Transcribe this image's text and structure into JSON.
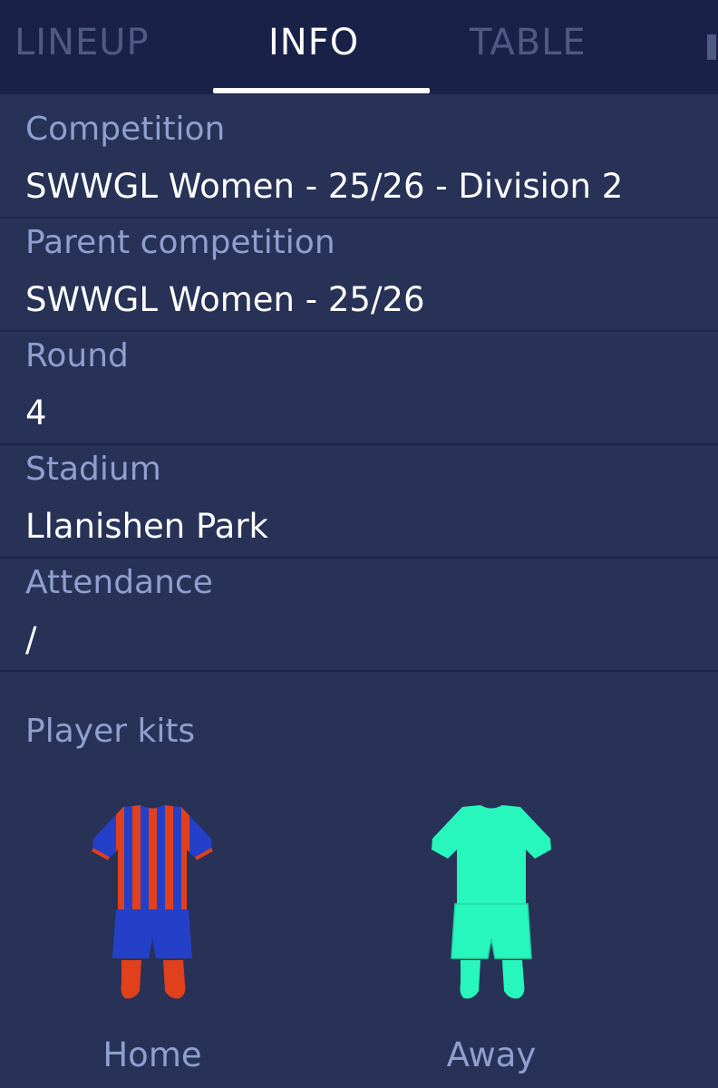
{
  "tabs": [
    {
      "label": "LINEUP",
      "active": false
    },
    {
      "label": "INFO",
      "active": true
    },
    {
      "label": "TABLE",
      "active": false
    }
  ],
  "info": {
    "competition": {
      "label": "Competition",
      "value": "SWWGL Women - 25/26 - Division 2"
    },
    "parent_competition": {
      "label": "Parent competition",
      "value": "SWWGL Women - 25/26"
    },
    "round": {
      "label": "Round",
      "value": "4"
    },
    "stadium": {
      "label": "Stadium",
      "value": "Llanishen Park"
    },
    "attendance": {
      "label": "Attendance",
      "value": "/"
    }
  },
  "kits": {
    "title": "Player kits",
    "home": {
      "label": "Home",
      "shirt_colors": [
        "#2440c8",
        "#e0401c"
      ],
      "shorts_color": "#2440c8",
      "socks_color": "#e0401c"
    },
    "away": {
      "label": "Away",
      "color": "#27f7bd"
    }
  },
  "colors": {
    "background": "#283257",
    "tabbar": "#1a2148",
    "label": "#8f9fcf",
    "value": "#ffffff"
  }
}
